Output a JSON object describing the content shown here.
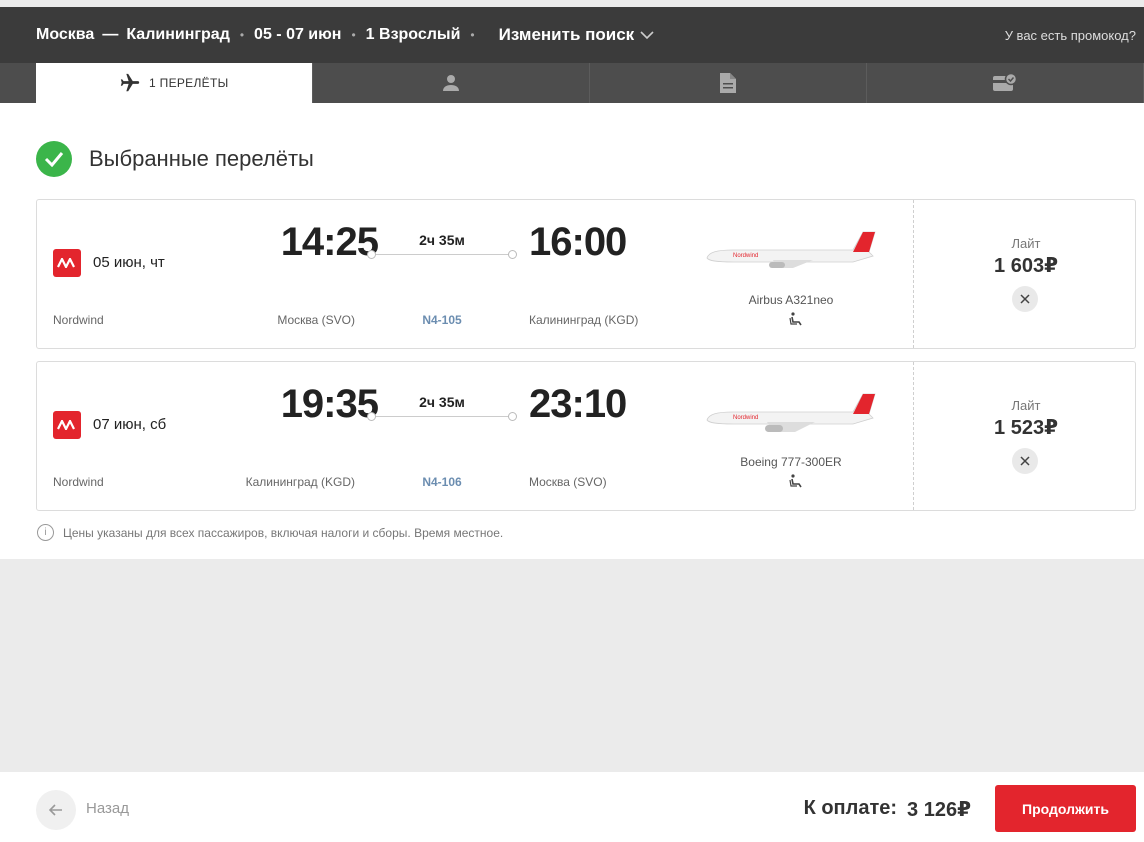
{
  "header": {
    "origin": "Москва",
    "destination": "Калининград",
    "route_separator": "—",
    "dates": "05 - 07 июн",
    "passengers": "1 Взрослый",
    "change_search": "Изменить поиск",
    "promo": "У вас есть промокод?"
  },
  "tabs": [
    {
      "label": "1 ПЕРЕЛЁТЫ",
      "icon": "plane-icon",
      "active": true
    },
    {
      "label": "",
      "icon": "person-icon",
      "active": false
    },
    {
      "label": "",
      "icon": "document-icon",
      "active": false
    },
    {
      "label": "",
      "icon": "payment-check-icon",
      "active": false
    }
  ],
  "section": {
    "title": "Выбранные перелёты"
  },
  "flights": [
    {
      "date": "05 июн, чт",
      "airline": "Nordwind",
      "dep_time": "14:25",
      "arr_time": "16:00",
      "duration": "2ч 35м",
      "dep_airport": "Москва (SVO)",
      "arr_airport": "Калининград (KGD)",
      "flight_no": "N4-105",
      "aircraft": "Airbus A321neo",
      "fare": "Лайт",
      "price": "1 603₽"
    },
    {
      "date": "07 июн, сб",
      "airline": "Nordwind",
      "dep_time": "19:35",
      "arr_time": "23:10",
      "duration": "2ч 35м",
      "dep_airport": "Калининград (KGD)",
      "arr_airport": "Москва (SVO)",
      "flight_no": "N4-106",
      "aircraft": "Boeing 777-300ER",
      "fare": "Лайт",
      "price": "1 523₽"
    }
  ],
  "note": "Цены указаны для всех пассажиров, включая налоги и сборы. Время местное.",
  "footer": {
    "back": "Назад",
    "total_label": "К оплате:",
    "total_value": "3 126₽",
    "continue": "Продолжить"
  },
  "colors": {
    "brand_red": "#e3252d",
    "success_green": "#3bb54a",
    "header_bg": "#3b3b3b",
    "flight_no_blue": "#6b8db0"
  }
}
